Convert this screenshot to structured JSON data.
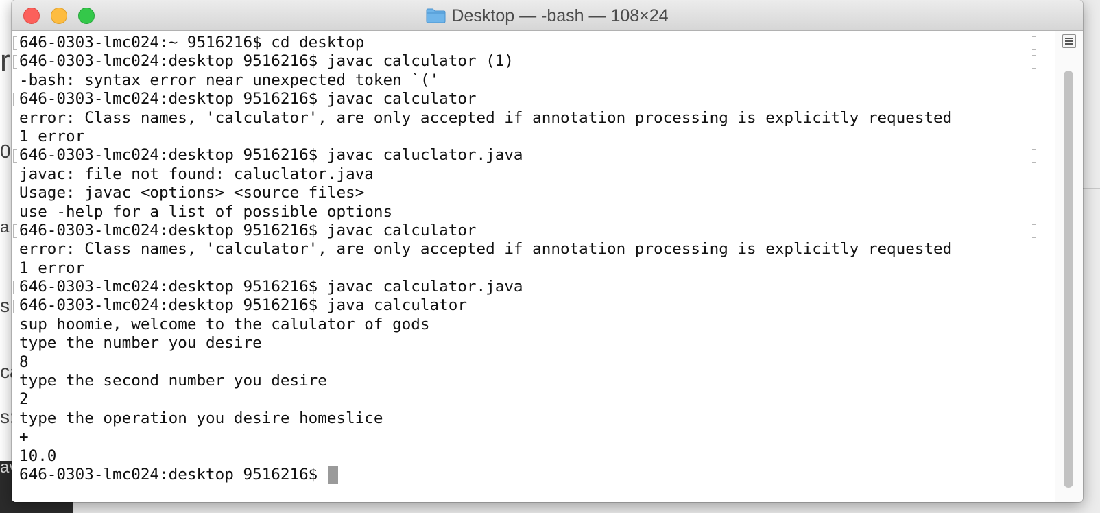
{
  "window": {
    "title": "Desktop — -bash — 108×24",
    "folder_icon": "folder-icon"
  },
  "background_fragments": [
    "r",
    "0",
    "a",
    "s",
    "ca",
    "s:",
    "av"
  ],
  "terminal": {
    "lines": [
      {
        "text": "646-0303-lmc024:~ 9516216$ cd desktop",
        "marked": true
      },
      {
        "text": "646-0303-lmc024:desktop 9516216$ javac calculator (1)",
        "marked": true
      },
      {
        "text": "-bash: syntax error near unexpected token `('",
        "marked": false
      },
      {
        "text": "646-0303-lmc024:desktop 9516216$ javac calculator",
        "marked": true
      },
      {
        "text": "error: Class names, 'calculator', are only accepted if annotation processing is explicitly requested",
        "marked": false
      },
      {
        "text": "1 error",
        "marked": false
      },
      {
        "text": "646-0303-lmc024:desktop 9516216$ javac caluclator.java",
        "marked": true
      },
      {
        "text": "javac: file not found: caluclator.java",
        "marked": false
      },
      {
        "text": "Usage: javac <options> <source files>",
        "marked": false
      },
      {
        "text": "use -help for a list of possible options",
        "marked": false
      },
      {
        "text": "646-0303-lmc024:desktop 9516216$ javac calculator",
        "marked": true
      },
      {
        "text": "error: Class names, 'calculator', are only accepted if annotation processing is explicitly requested",
        "marked": false
      },
      {
        "text": "1 error",
        "marked": false
      },
      {
        "text": "646-0303-lmc024:desktop 9516216$ javac calculator.java",
        "marked": true
      },
      {
        "text": "646-0303-lmc024:desktop 9516216$ java calculator",
        "marked": true
      },
      {
        "text": "sup hoomie, welcome to the calulator of gods",
        "marked": false
      },
      {
        "text": "type the number you desire",
        "marked": false
      },
      {
        "text": "8",
        "marked": false
      },
      {
        "text": "type the second number you desire",
        "marked": false
      },
      {
        "text": "2",
        "marked": false
      },
      {
        "text": "type the operation you desire homeslice",
        "marked": false
      },
      {
        "text": "+",
        "marked": false
      },
      {
        "text": "10.0",
        "marked": false
      }
    ],
    "prompt": "646-0303-lmc024:desktop 9516216$ "
  }
}
